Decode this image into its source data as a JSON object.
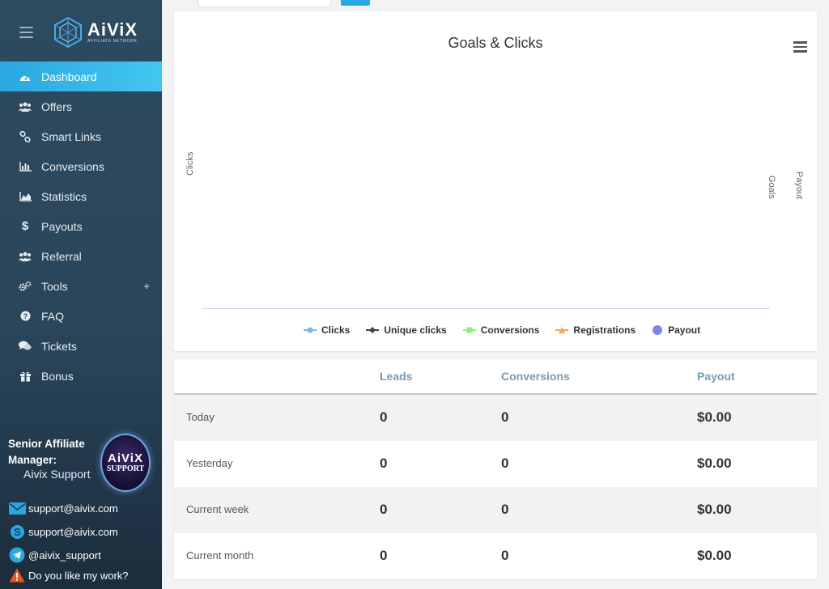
{
  "brand": {
    "logo_text": "AiViX",
    "logo_subtext": "AFFILIATE NETWORK"
  },
  "sidebar": {
    "items": [
      {
        "label": "Dashboard",
        "icon": "dashboard-icon",
        "active": true
      },
      {
        "label": "Offers",
        "icon": "users-icon"
      },
      {
        "label": "Smart Links",
        "icon": "link-icon"
      },
      {
        "label": "Conversions",
        "icon": "bar-chart-icon"
      },
      {
        "label": "Statistics",
        "icon": "area-chart-icon"
      },
      {
        "label": "Payouts",
        "icon": "dollar-icon"
      },
      {
        "label": "Referral",
        "icon": "users-icon"
      },
      {
        "label": "Tools",
        "icon": "cogs-icon",
        "expandable": true
      },
      {
        "label": "FAQ",
        "icon": "question-circle-icon"
      },
      {
        "label": "Tickets",
        "icon": "comments-icon"
      },
      {
        "label": "Bonus",
        "icon": "gift-icon"
      }
    ],
    "tools_expand": "+",
    "manager": {
      "title": "Senior Affiliate Manager:",
      "name": "Aivix Support",
      "badge_line1": "AiViX",
      "badge_line2": "SUPPORT"
    },
    "contacts": [
      {
        "icon": "envelope-icon",
        "text": "support@aivix.com"
      },
      {
        "icon": "skype-icon",
        "text": "support@aivix.com"
      },
      {
        "icon": "telegram-icon",
        "text": "@aivix_support"
      },
      {
        "icon": "warning-icon",
        "text": "Do you like my work?"
      }
    ]
  },
  "chart": {
    "menu_icon": "hamburger-menu-icon"
  },
  "chart_data": {
    "type": "line",
    "title": "Goals & Clicks",
    "ylabel": "Clicks",
    "ylabel_right": [
      "Goals",
      "Payout"
    ],
    "series": [
      {
        "name": "Clicks",
        "color": "#7cb5ec",
        "values": []
      },
      {
        "name": "Unique clicks",
        "color": "#434348",
        "values": []
      },
      {
        "name": "Conversions",
        "color": "#90ed7d",
        "values": []
      },
      {
        "name": "Registrations",
        "color": "#f7a35c",
        "values": []
      },
      {
        "name": "Payout",
        "color": "#8085e9",
        "values": []
      }
    ],
    "legend": "bottom"
  },
  "stats": {
    "headers": [
      "Leads",
      "Conversions",
      "Payout"
    ],
    "rows": [
      {
        "label": "Today",
        "leads": "0",
        "conversions": "0",
        "payout": "$0.00"
      },
      {
        "label": "Yesterday",
        "leads": "0",
        "conversions": "0",
        "payout": "$0.00"
      },
      {
        "label": "Current week",
        "leads": "0",
        "conversions": "0",
        "payout": "$0.00"
      },
      {
        "label": "Current month",
        "leads": "0",
        "conversions": "0",
        "payout": "$0.00"
      }
    ]
  },
  "colors": {
    "accent": "#2aa7e0",
    "sidebar_bg": "#2c4a60",
    "header_text": "#7b9aae"
  }
}
